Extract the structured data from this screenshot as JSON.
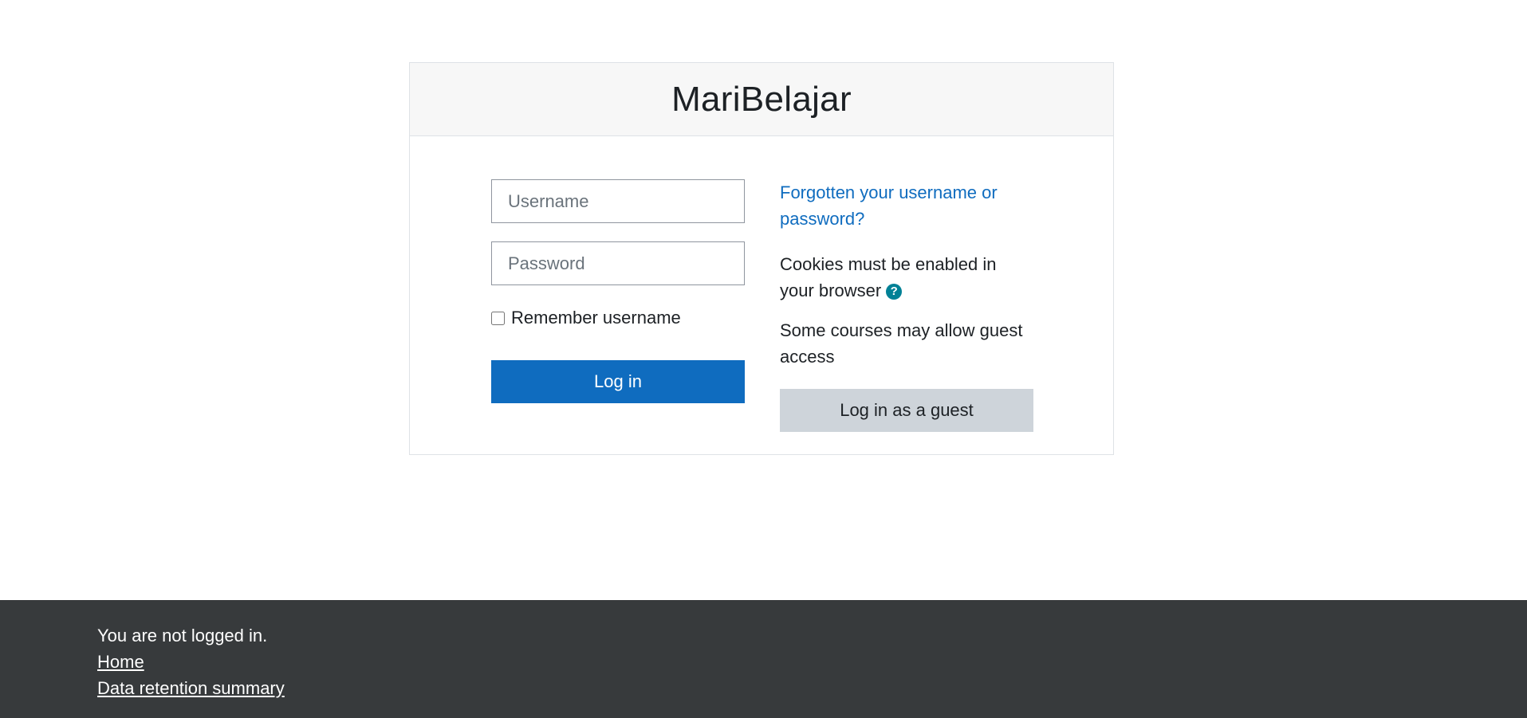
{
  "site": {
    "title": "MariBelajar"
  },
  "login_form": {
    "username_placeholder": "Username",
    "password_placeholder": "Password",
    "remember_label": "Remember username",
    "login_button": "Log in"
  },
  "side_info": {
    "forgot_link": "Forgotten your username or password?",
    "cookies_text": "Cookies must be enabled in your browser",
    "help_icon": "question-circle-icon",
    "guest_text": "Some courses may allow guest access",
    "guest_button": "Log in as a guest"
  },
  "footer": {
    "login_status": "You are not logged in.",
    "home_link": "Home",
    "data_retention_link": "Data retention summary"
  },
  "colors": {
    "primary": "#0f6cbf",
    "secondary_button": "#ced4da",
    "help_icon": "#008196",
    "footer_bg": "#373a3c",
    "header_bg": "#f7f7f7"
  }
}
